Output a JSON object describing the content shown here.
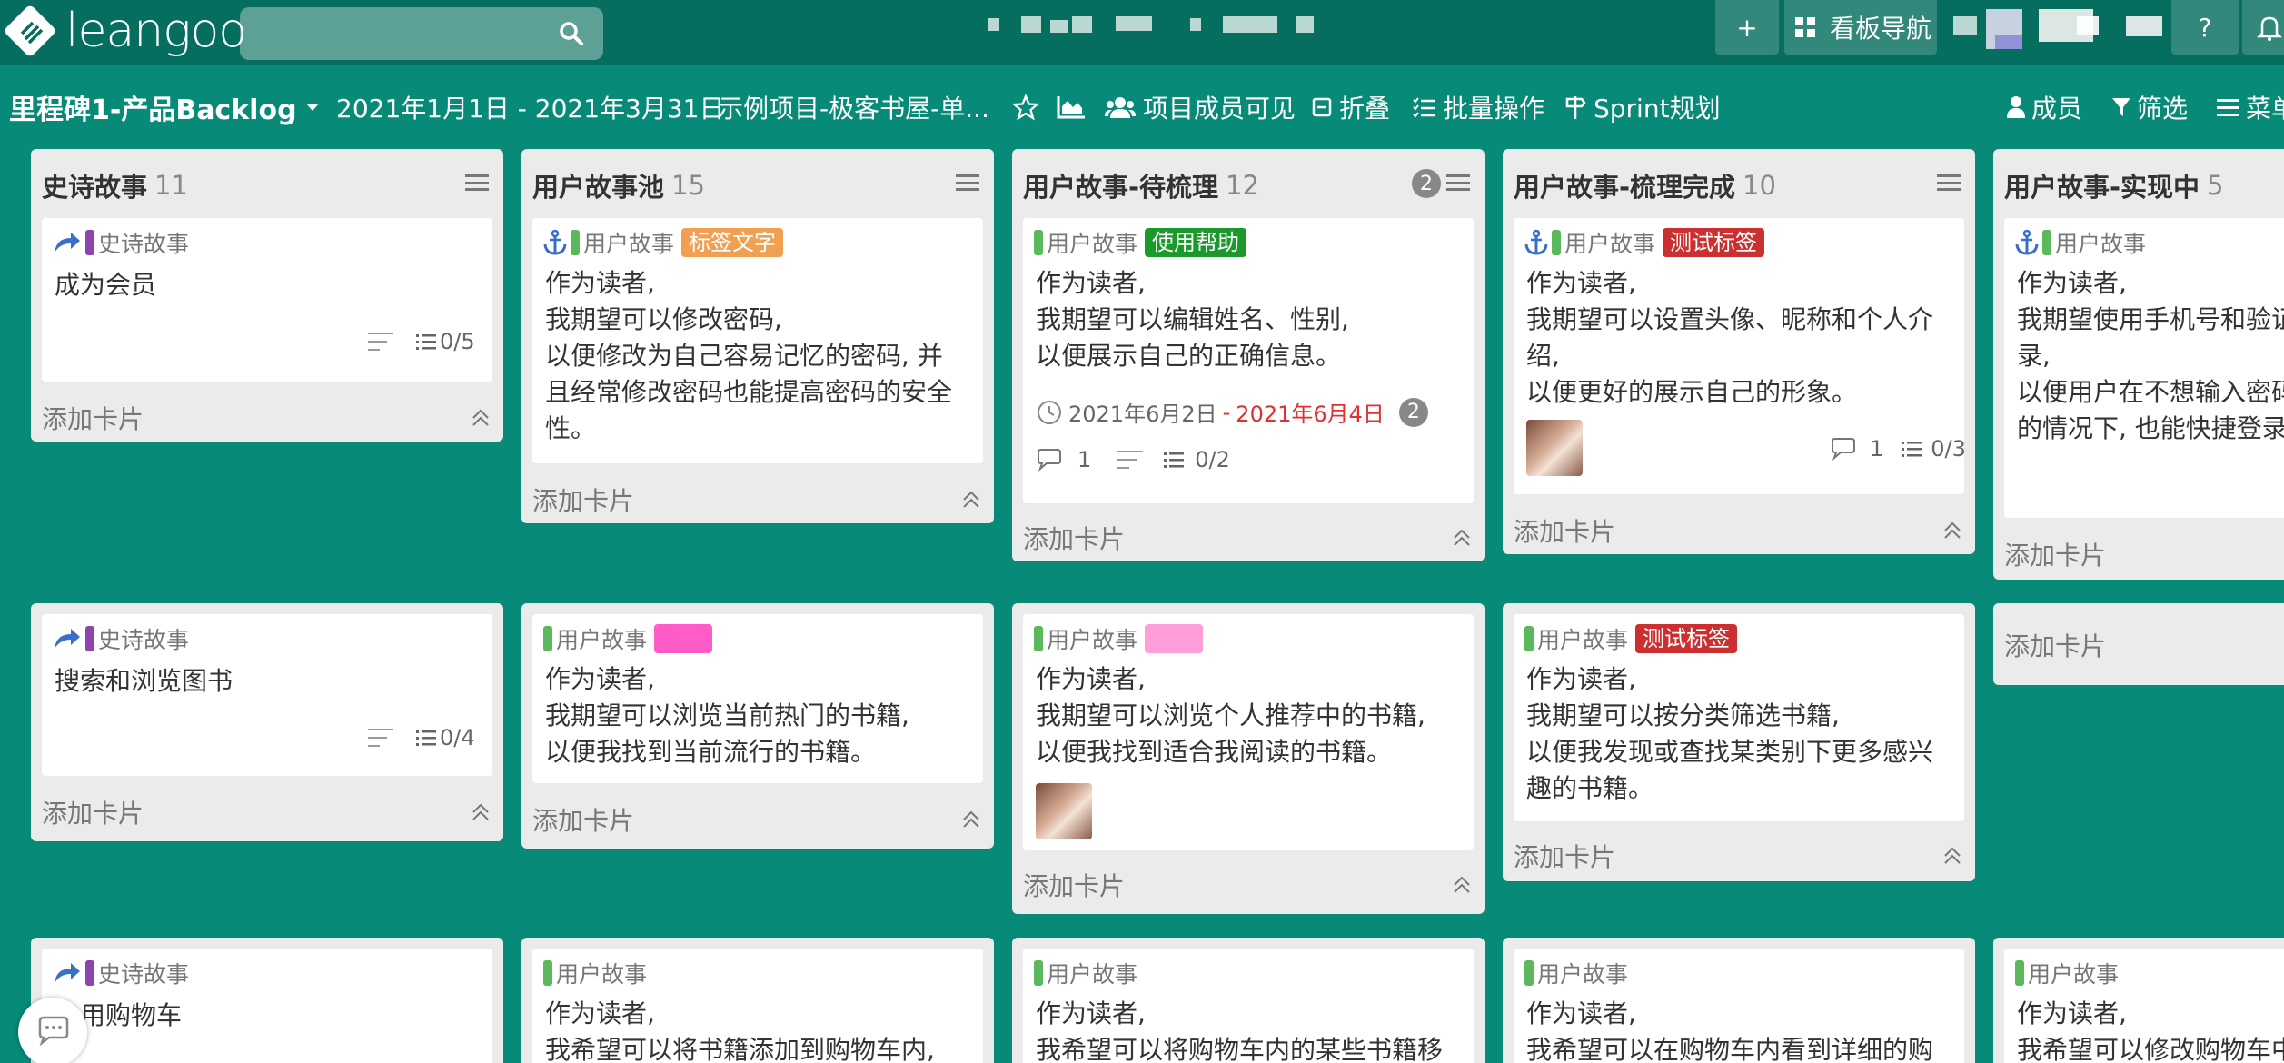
{
  "app": {
    "logo_text": "leangoo"
  },
  "header": {
    "add_label": "+",
    "nav_label": "看板导航",
    "help_label": "?"
  },
  "subbar": {
    "board_title": "里程碑1-产品Backlog",
    "date_range": "2021年1月1日 - 2021年3月31日",
    "project": "示例项目-极客书屋-单...",
    "visibility": "项目成员可见",
    "fold": "折叠",
    "batch": "批量操作",
    "sprint": "Sprint规划",
    "members": "成员",
    "filter": "筛选",
    "menu": "菜单"
  },
  "colors": {
    "bg": "#078a77",
    "epic": "#8e44ad",
    "story": "#5cb85c"
  },
  "lists": [
    {
      "name": "史诗故事",
      "count": "11"
    },
    {
      "name": "用户故事池",
      "count": "15"
    },
    {
      "name": "用户故事-待梳理",
      "count": "12",
      "badge": "2"
    },
    {
      "name": "用户故事-梳理完成",
      "count": "10"
    },
    {
      "name": "用户故事-实现中",
      "count": "5"
    }
  ],
  "common": {
    "add_card": "添加卡片",
    "epic_type": "史诗故事",
    "story_type": "用户故事"
  },
  "cards": {
    "c00": {
      "title": "成为会员",
      "checklist": "0/5"
    },
    "c01": {
      "tag": "标签文字",
      "lines": [
        "作为读者,",
        "我期望可以修改密码,",
        "以便修改为自己容易记忆的密码, 并",
        "且经常修改密码也能提高密码的安全",
        "性。"
      ]
    },
    "c02": {
      "tag": "使用帮助",
      "lines": [
        "作为读者,",
        "我期望可以编辑姓名、性别,",
        "以便展示自己的正确信息。"
      ],
      "date_start": "2021年6月2日",
      "date_sep": "-",
      "date_end": "2021年6月4日",
      "date_badge": "2",
      "comments": "1",
      "checklist": "0/2"
    },
    "c03": {
      "tag": "测试标签",
      "lines": [
        "作为读者,",
        "我期望可以设置头像、昵称和个人介",
        "绍,",
        "以便更好的展示自己的形象。"
      ],
      "comments": "1",
      "checklist": "0/3"
    },
    "c04": {
      "lines": [
        "作为读者,",
        "我期望使用手机号和验证",
        "录,",
        "以便用户在不想输入密码",
        "的情况下, 也能快捷登录"
      ]
    },
    "c10": {
      "title": "搜索和浏览图书",
      "checklist": "0/4"
    },
    "c11": {
      "lines": [
        "作为读者,",
        "我期望可以浏览当前热门的书籍,",
        "以便我找到当前流行的书籍。"
      ]
    },
    "c12": {
      "lines": [
        "作为读者,",
        "我期望可以浏览个人推荐中的书籍,",
        "以便我找到适合我阅读的书籍。"
      ]
    },
    "c13": {
      "tag": "测试标签",
      "lines": [
        "作为读者,",
        "我期望可以按分类筛选书籍,",
        "以便我发现或查找某类别下更多感兴",
        "趣的书籍。"
      ]
    },
    "c20": {
      "title": "用购物车"
    },
    "c21": {
      "lines": [
        "作为读者,",
        "我希望可以将书籍添加到购物车内,"
      ]
    },
    "c22": {
      "lines": [
        "作为读者,",
        "我希望可以将购物车内的某些书籍移"
      ]
    },
    "c23": {
      "lines": [
        "作为读者,",
        "我希望可以在购物车内看到详细的购"
      ]
    },
    "c24": {
      "lines": [
        "作为读者,",
        "我希望可以修改购物车中"
      ]
    }
  }
}
